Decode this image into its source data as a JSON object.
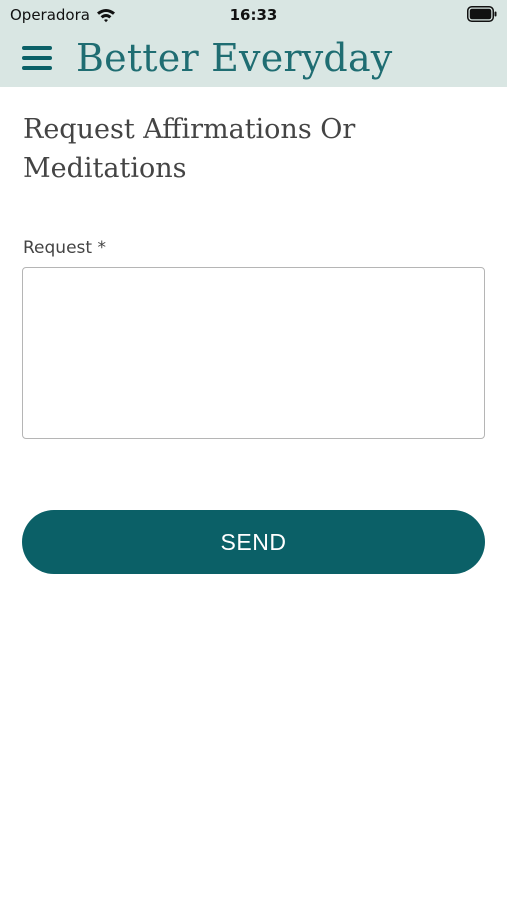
{
  "status_bar": {
    "carrier": "Operadora",
    "time": "16:33",
    "wifi_icon": "wifi-icon",
    "battery_icon": "battery-icon"
  },
  "header": {
    "menu_icon": "hamburger-menu-icon",
    "title": "Better Everyday"
  },
  "form": {
    "title": "Request Affirmations Or Meditations",
    "request_label": "Request *",
    "request_value": "",
    "request_placeholder": "",
    "send_label": "SEND"
  },
  "colors": {
    "header_background": "#d9e6e3",
    "brand": "#1f6d72",
    "button": "#0b6067",
    "button_text": "#ffffff",
    "body_text": "#444444"
  }
}
